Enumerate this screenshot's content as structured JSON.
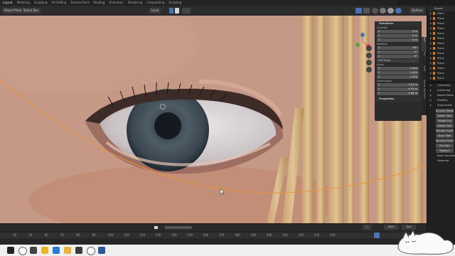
{
  "top_tabs": [
    "Layout",
    "Modeling",
    "Sculpting",
    "UV Editing",
    "Texture Paint",
    "Shading",
    "Animation",
    "Rendering",
    "Compositing",
    "Scripting"
  ],
  "header": {
    "mode": "Object Mode",
    "select": "Select Box",
    "transform_orientation": "Local",
    "options": "Options"
  },
  "npanel": {
    "transform_title": "Transform",
    "location_label": "Location",
    "location": [
      {
        "axis": "X",
        "value": "0 m"
      },
      {
        "axis": "Y",
        "value": "0 m"
      },
      {
        "axis": "Z",
        "value": "0 m"
      }
    ],
    "rotation_label": "Rotation",
    "rotation": [
      {
        "axis": "X",
        "value": "90°"
      },
      {
        "axis": "Y",
        "value": "0°"
      },
      {
        "axis": "Z",
        "value": "0°"
      }
    ],
    "rotation_mode": "XYZ Euler",
    "scale_label": "Scale",
    "scale": [
      {
        "axis": "X",
        "value": "1.000"
      },
      {
        "axis": "Y",
        "value": "1.000"
      },
      {
        "axis": "Z",
        "value": "1.000"
      }
    ],
    "dimensions_label": "Dimensions",
    "dimensions": [
      {
        "axis": "X",
        "value": "1.51 m"
      },
      {
        "axis": "Y",
        "value": "4.79 m"
      },
      {
        "axis": "Z",
        "value": "1.86 m"
      }
    ],
    "properties_title": "Properties"
  },
  "npanel_tabs": [
    "Item",
    "Tool",
    "View",
    "Sorcar HairTools"
  ],
  "timeline": {
    "start_label": "Start",
    "start_value": "1",
    "end_label": "End",
    "frame_numbers": [
      "40",
      "50",
      "60",
      "70",
      "80",
      "90",
      "100",
      "110",
      "120",
      "130",
      "140",
      "150",
      "160",
      "170",
      "180",
      "190",
      "200",
      "210",
      "220",
      "230",
      "240"
    ]
  },
  "outliner": {
    "title": "Scene",
    "items": [
      "Plane",
      "Plane",
      "Plane",
      "Plane",
      "Plane",
      "Plane",
      "Plane",
      "Plane",
      "Plane",
      "Plane",
      "Plane",
      "Plane",
      "Plane",
      "Plane"
    ]
  },
  "properties": {
    "sections": [
      "Collections",
      "Instancing",
      "Motion Paths",
      "Visibility",
      "StyleLashes"
    ],
    "buttons": [
      "Random Rotation",
      "Rotate Start",
      "Rotate End",
      "Rotate Start",
      "Random Scale",
      "Scale Start",
      "Random Position",
      "Pos Start",
      "Rotation"
    ],
    "labels": [
      "Rake Generator",
      "Generate"
    ]
  },
  "taskbar": {
    "icons": [
      "windows-start",
      "search",
      "task-view",
      "chrome",
      "edge",
      "file-explorer",
      "blender",
      "clock-app",
      "word"
    ]
  },
  "colors": {
    "accent_orange": "#e8933a",
    "selection_orange": "#d97a2b",
    "button_blue": "#4772b3",
    "panel_dark": "#2b2b2b"
  }
}
